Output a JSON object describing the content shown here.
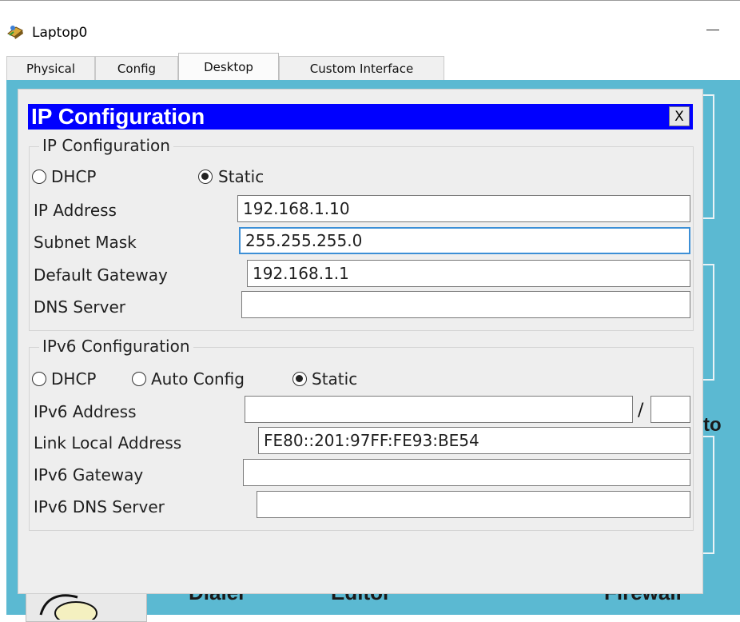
{
  "window": {
    "title": "Laptop0"
  },
  "tabs": [
    {
      "label": "Physical",
      "active": false
    },
    {
      "label": "Config",
      "active": false
    },
    {
      "label": "Desktop",
      "active": true
    },
    {
      "label": "Custom Interface",
      "active": false
    }
  ],
  "background_labels": {
    "dialer": "Dialer",
    "editor": "Editor",
    "firewall": "Firewall",
    "partial": "to"
  },
  "dialog": {
    "title": "IP Configuration",
    "close_label": "X",
    "ipv4": {
      "group_title": "IP Configuration",
      "mode_options": [
        "DHCP",
        "Static"
      ],
      "selected_mode": "Static",
      "ip_address_label": "IP Address",
      "ip_address": "192.168.1.10",
      "subnet_mask_label": "Subnet Mask",
      "subnet_mask": "255.255.255.0",
      "default_gateway_label": "Default Gateway",
      "default_gateway": "192.168.1.1",
      "dns_server_label": "DNS Server",
      "dns_server": ""
    },
    "ipv6": {
      "group_title": "IPv6 Configuration",
      "mode_options": [
        "DHCP",
        "Auto Config",
        "Static"
      ],
      "selected_mode": "Static",
      "ipv6_address_label": "IPv6 Address",
      "ipv6_address": "",
      "prefix_separator": "/",
      "prefix_length": "",
      "link_local_label": "Link Local Address",
      "link_local_address": "FE80::201:97FF:FE93:BE54",
      "gateway_label": "IPv6 Gateway",
      "gateway": "",
      "dns_label": "IPv6 DNS Server",
      "dns": ""
    }
  },
  "colors": {
    "title_bar": "#0000ff",
    "desktop_bg": "#5bb9d2",
    "focus_border": "#3c8fd6"
  }
}
